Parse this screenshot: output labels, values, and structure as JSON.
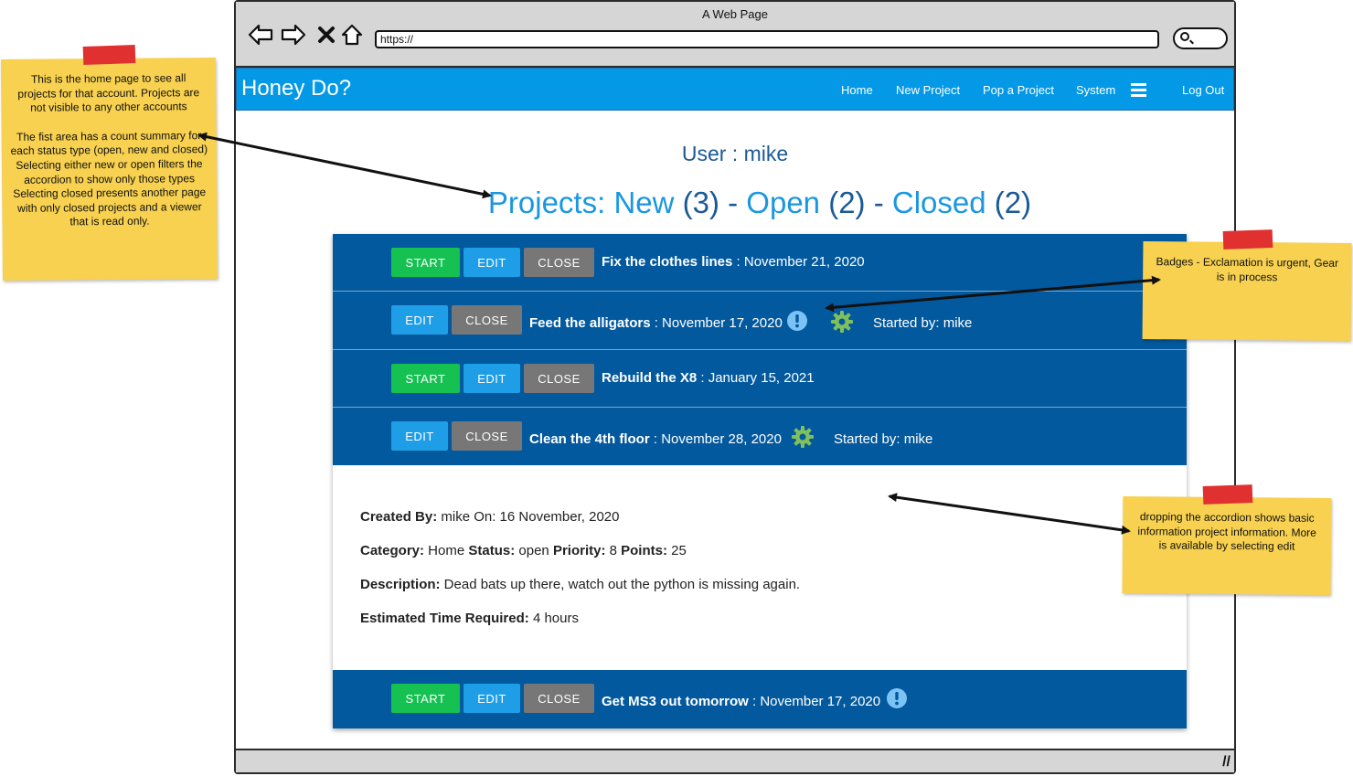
{
  "window": {
    "title": "A Web Page",
    "url": "https://"
  },
  "app": {
    "brand": "Honey Do?",
    "nav": {
      "home": "Home",
      "new_project": "New Project",
      "pop_project": "Pop a Project",
      "system": "System",
      "logout": "Log Out"
    }
  },
  "user_line": "User : mike",
  "summary": {
    "prefix": "Projects: ",
    "new_label": "New",
    "new_count": " (3) - ",
    "open_label": "Open",
    "open_count": " (2) - ",
    "closed_label": "Closed",
    "closed_count": " (2)"
  },
  "buttons": {
    "start": "START",
    "edit": "EDIT",
    "close": "CLOSE"
  },
  "projects": [
    {
      "name": "Fix the clothes lines",
      "date": " : November 21, 2020",
      "started_by": "",
      "badges": []
    },
    {
      "name": "Feed the alligators",
      "date": " : November 17, 2020",
      "started_label": "Started by:",
      "started_by": " mike",
      "badges": [
        "exclamation-icon",
        "gear-icon"
      ]
    },
    {
      "name": "Rebuild the X8",
      "date": " : January 15, 2021",
      "started_by": "",
      "badges": []
    },
    {
      "name": "Clean the 4th floor",
      "date": " : November 28, 2020",
      "started_label": "Started by:",
      "started_by": " mike",
      "badges": [
        "gear-icon"
      ]
    },
    {
      "name": "Get MS3 out tomorrow",
      "date": " : November 17, 2020",
      "started_by": "",
      "badges": [
        "exclamation-icon"
      ]
    }
  ],
  "detail": {
    "created_label": "Created By:",
    "created_value": " mike On: 16 November, 2020",
    "category_label": "Category:",
    "category_value": " Home ",
    "status_label": "Status:",
    "status_value": " open ",
    "priority_label": "Priority:",
    "priority_value": " 8 ",
    "points_label": "Points:",
    "points_value": " 25",
    "description_label": "Description:",
    "description_value": " Dead bats up there, watch out the python is missing again.",
    "time_label": "Estimated Time Required:",
    "time_value": " 4 hours"
  },
  "notes": {
    "home": {
      "p1": "This is the home page to see all projects for that account.  Projects are not visible to any other accounts",
      "p2": "The fist area has a count summary for each status type (open, new and closed)",
      "p3": "Selecting either new or open filters the accordion to show only those types",
      "p4": "Selecting closed presents another page with only closed projects and a viewer that is read only."
    },
    "badges": "Badges - Exclamation is urgent, Gear is in process",
    "accordion": "dropping the accordion shows basic information project information.  More is available by selecting edit"
  },
  "colors": {
    "navbar": "#0399e6",
    "row": "#03599e",
    "start": "#14c151",
    "edit": "#1f9ee8",
    "close": "#777777",
    "note": "#f7d14f",
    "tape": "#e03030"
  }
}
